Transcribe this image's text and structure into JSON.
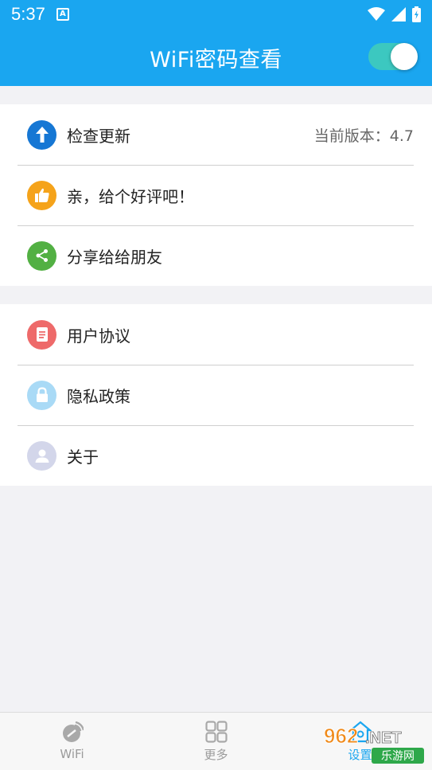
{
  "status_bar": {
    "time": "5:37",
    "notification_icon": "A"
  },
  "app_bar": {
    "title": "WiFi密码查看",
    "toggle_on": true
  },
  "settings_group_1": [
    {
      "label": "检查更新",
      "value": "当前版本：4.7",
      "icon": "arrow-up-icon",
      "color": "#1677d4"
    },
    {
      "label": "亲，给个好评吧！",
      "icon": "thumbs-up-icon",
      "color": "#f5a31a"
    },
    {
      "label": "分享给给朋友",
      "icon": "share-icon",
      "color": "#52b043"
    }
  ],
  "settings_group_2": [
    {
      "label": "用户协议",
      "icon": "document-icon",
      "color": "#ee6a6a"
    },
    {
      "label": "隐私政策",
      "icon": "lock-icon",
      "color": "#a9daf6"
    },
    {
      "label": "关于",
      "icon": "user-icon",
      "color": "#d3d6ea"
    }
  ],
  "tab_bar": {
    "tabs": [
      {
        "label": "WiFi",
        "icon": "wifi-signal-icon"
      },
      {
        "label": "更多",
        "icon": "grid-icon"
      },
      {
        "label": "设置",
        "icon": "settings-home-icon"
      }
    ]
  },
  "watermark": {
    "text_top": "962.NET",
    "text_bottom": "乐游网"
  }
}
